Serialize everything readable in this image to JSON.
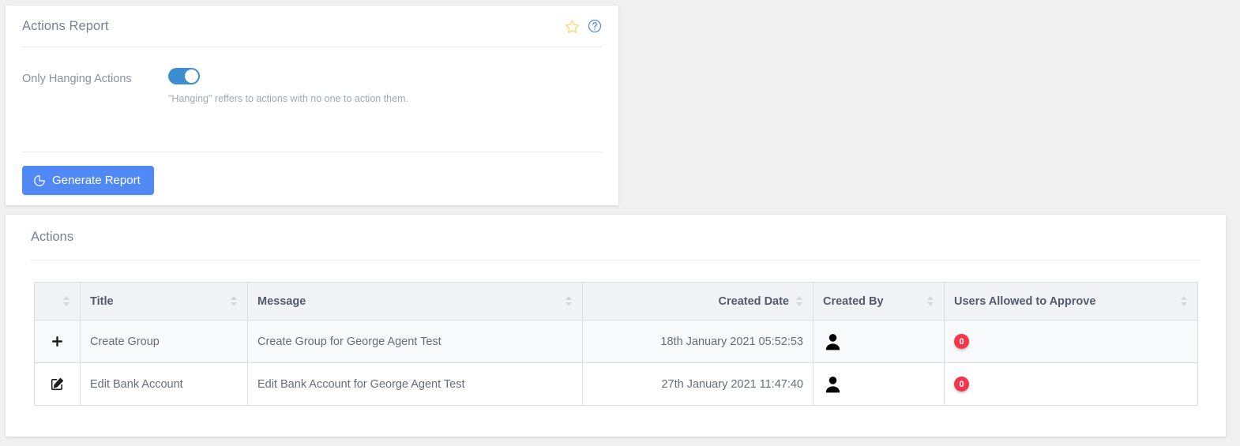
{
  "report_card": {
    "title": "Actions Report",
    "icons": {
      "favorite": "star-icon",
      "help": "help-circle-icon"
    },
    "toggle": {
      "label": "Only Hanging Actions",
      "state": "on",
      "help_text": "\"Hanging\" reffers to actions with no one to action them."
    },
    "generate_button": {
      "label": "Generate Report",
      "icon": "pie-chart-icon",
      "color": "#5088f5"
    }
  },
  "actions_card": {
    "title": "Actions",
    "table": {
      "columns": [
        {
          "label": "",
          "align": "left",
          "sortable": true
        },
        {
          "label": "Title",
          "align": "left",
          "sortable": true
        },
        {
          "label": "Message",
          "align": "left",
          "sortable": true
        },
        {
          "label": "Created Date",
          "align": "right",
          "sortable": true
        },
        {
          "label": "Created By",
          "align": "left",
          "sortable": true
        },
        {
          "label": "Users Allowed to Approve",
          "align": "left",
          "sortable": true
        }
      ],
      "rows": [
        {
          "expand_icon": "plus-icon",
          "title": "Create Group",
          "message": "Create Group for George Agent Test",
          "created_date": "18th January 2021 05:52:53",
          "created_by_icon": "user-avatar-icon",
          "approvers_count": "0"
        },
        {
          "expand_icon": "edit-square-icon",
          "title": "Edit Bank Account",
          "message": "Edit Bank Account for George Agent Test",
          "created_date": "27th January 2021 11:47:40",
          "created_by_icon": "user-avatar-icon",
          "approvers_count": "0"
        }
      ]
    }
  },
  "colors": {
    "accent": "#5088f5",
    "toggle_on": "#3d8ed1",
    "badge": "#f4364c",
    "star": "#f8d775",
    "help": "#4f8fe0",
    "page_bg": "#f0f0f0"
  }
}
